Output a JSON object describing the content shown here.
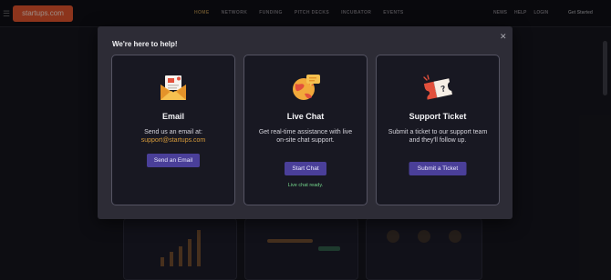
{
  "background": {
    "menu_icon": "menu-icon",
    "logo_text": "startups.com",
    "nav": [
      "HOME",
      "NETWORK",
      "FUNDING",
      "PITCH DECKS",
      "INCUBATOR",
      "EVENTS"
    ],
    "nav_right": [
      "NEWS",
      "HELP",
      "LOGIN"
    ],
    "user": "Get Started"
  },
  "modal": {
    "title": "We're here to help!",
    "close_icon": "close-icon",
    "cards": [
      {
        "icon": "envelope-icon",
        "title": "Email",
        "desc_prefix": "Send us an email at:",
        "email": "support@startups.com",
        "button": "Send an Email"
      },
      {
        "icon": "chat-globe-icon",
        "title": "Live Chat",
        "desc": "Get real-time assistance with live on-site chat support.",
        "button": "Start Chat",
        "status": "Live chat ready."
      },
      {
        "icon": "ticket-icon",
        "title": "Support Ticket",
        "desc": "Submit a ticket to our support team and they'll follow up.",
        "button": "Submit a Ticket"
      }
    ]
  },
  "colors": {
    "accent": "#4a3f99",
    "link": "#d69a3a",
    "ready": "#74d68c",
    "logo": "#d8512b"
  }
}
